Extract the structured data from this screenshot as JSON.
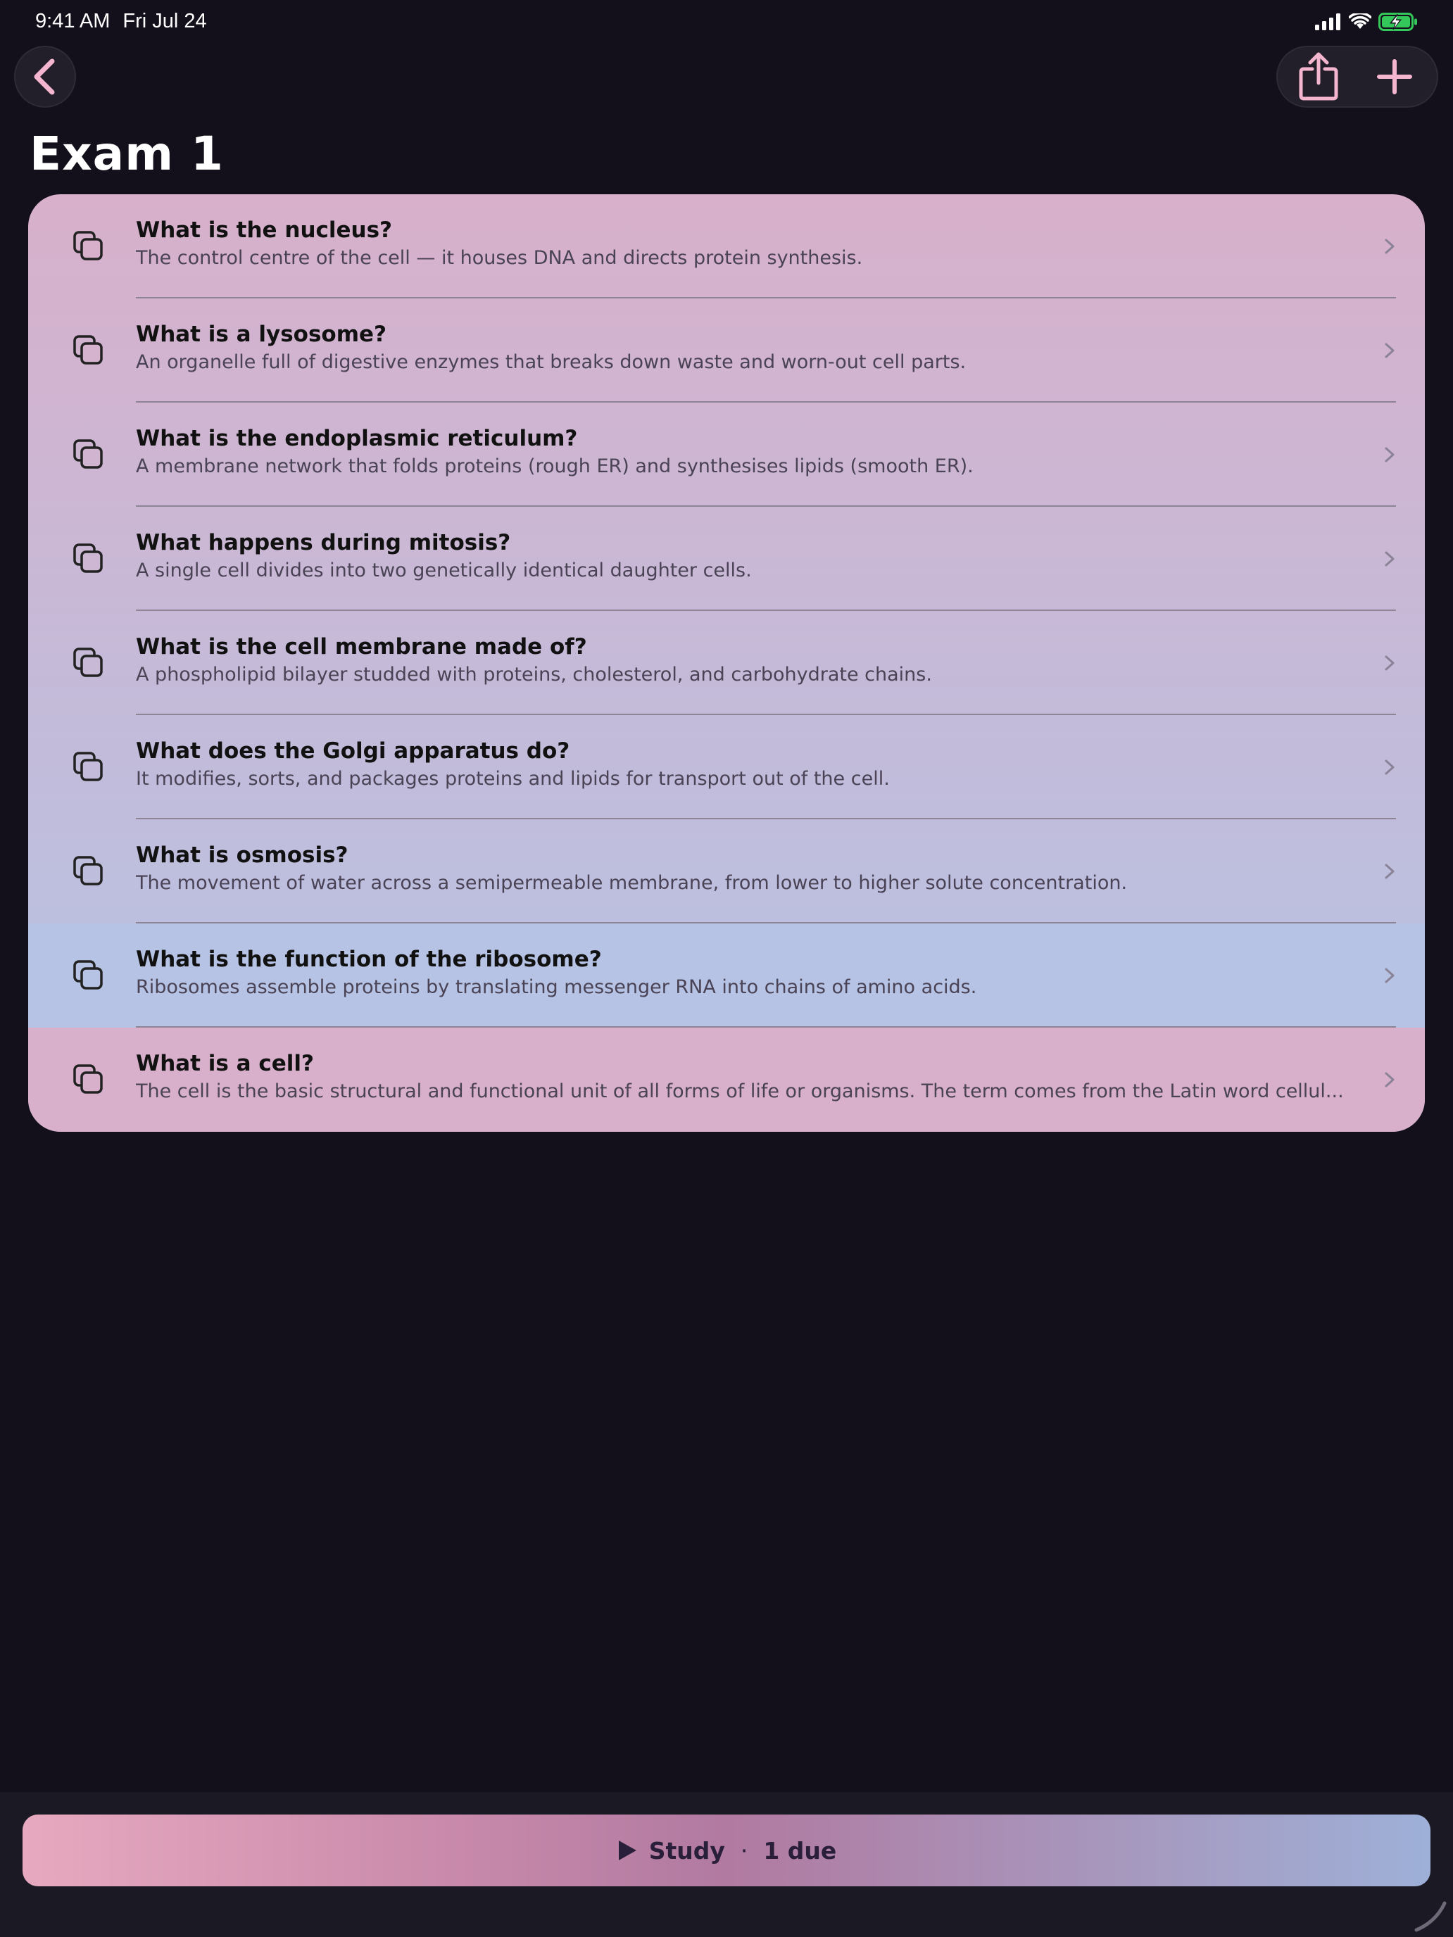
{
  "status_bar": {
    "time": "9:41 AM",
    "date": "Fri Jul 24",
    "battery_color": "#34c759"
  },
  "nav": {
    "back_icon": "chevron-left-icon",
    "share_icon": "share-icon",
    "add_icon": "plus-icon",
    "accent_color": "#f4b6cf"
  },
  "page": {
    "title": "Exam 1"
  },
  "cards": [
    {
      "question": "What is the nucleus?",
      "answer": "The control centre of the cell — it houses DNA and directs protein synthesis."
    },
    {
      "question": "What is a lysosome?",
      "answer": "An organelle full of digestive enzymes that breaks down waste and worn-out cell parts."
    },
    {
      "question": "What is the endoplasmic reticulum?",
      "answer": "A membrane network that folds proteins (rough ER) and synthesises lipids (smooth ER)."
    },
    {
      "question": "What happens during mitosis?",
      "answer": "A single cell divides into two genetically identical daughter cells."
    },
    {
      "question": "What is the cell membrane made of?",
      "answer": "A phospholipid bilayer studded with proteins, cholesterol, and carbohydrate chains."
    },
    {
      "question": "What does the Golgi apparatus do?",
      "answer": "It modifies, sorts, and packages proteins and lipids for transport out of the cell."
    },
    {
      "question": "What is osmosis?",
      "answer": "The movement of water across a semipermeable membrane, from lower to higher solute concentration."
    },
    {
      "question": "What is the function of the ribosome?",
      "answer": "Ribosomes assemble proteins by translating messenger RNA into chains of amino acids."
    },
    {
      "question": "What is a cell?",
      "answer": "The cell is the basic structural and functional unit of all forms of life or organisms. The term comes from the Latin word cellul..."
    }
  ],
  "study": {
    "label": "Study",
    "separator": "·",
    "due": "1 due",
    "icon": "play-icon"
  }
}
